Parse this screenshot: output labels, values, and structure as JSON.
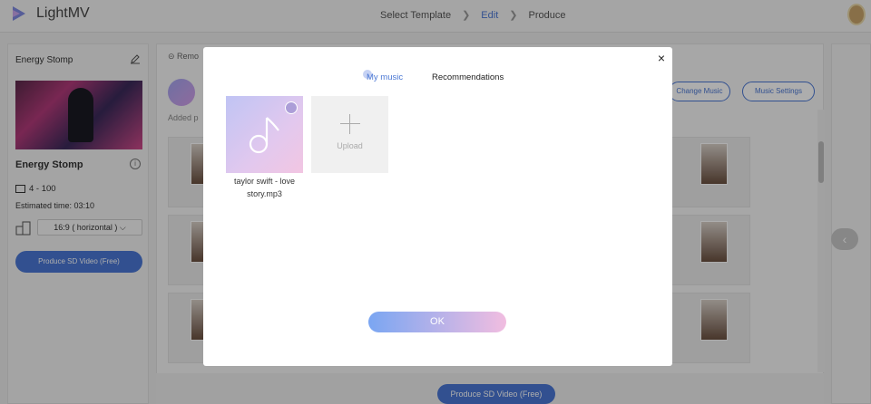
{
  "header": {
    "app_name": "LightMV",
    "steps": [
      "Select Template",
      "Edit",
      "Produce"
    ],
    "active_step": "Edit"
  },
  "left_panel": {
    "project_name": "Energy Stomp",
    "template_title": "Energy Stomp",
    "photo_range": "4 - 100",
    "estimated_time": "Estimated time: 03:10",
    "aspect_ratio": "16:9 ( horizontal )",
    "produce_button": "Produce SD Video (Free)"
  },
  "center_panel": {
    "remove_label": "Remo",
    "added_label": "Added p",
    "change_music_button": "Change Music",
    "music_settings_button": "Music Settings",
    "produce_button": "Produce SD Video (Free)"
  },
  "modal": {
    "tabs": [
      "My music",
      "Recommendations"
    ],
    "active_tab": "My music",
    "music_items": [
      {
        "name": "taylor swift - love story.mp3"
      }
    ],
    "upload_label": "Upload",
    "ok_button": "OK",
    "close_label": "×"
  },
  "colors": {
    "accent": "#4a77d4",
    "ok_gradient_start": "#7aa6f2",
    "ok_gradient_end": "#f1bde0"
  }
}
